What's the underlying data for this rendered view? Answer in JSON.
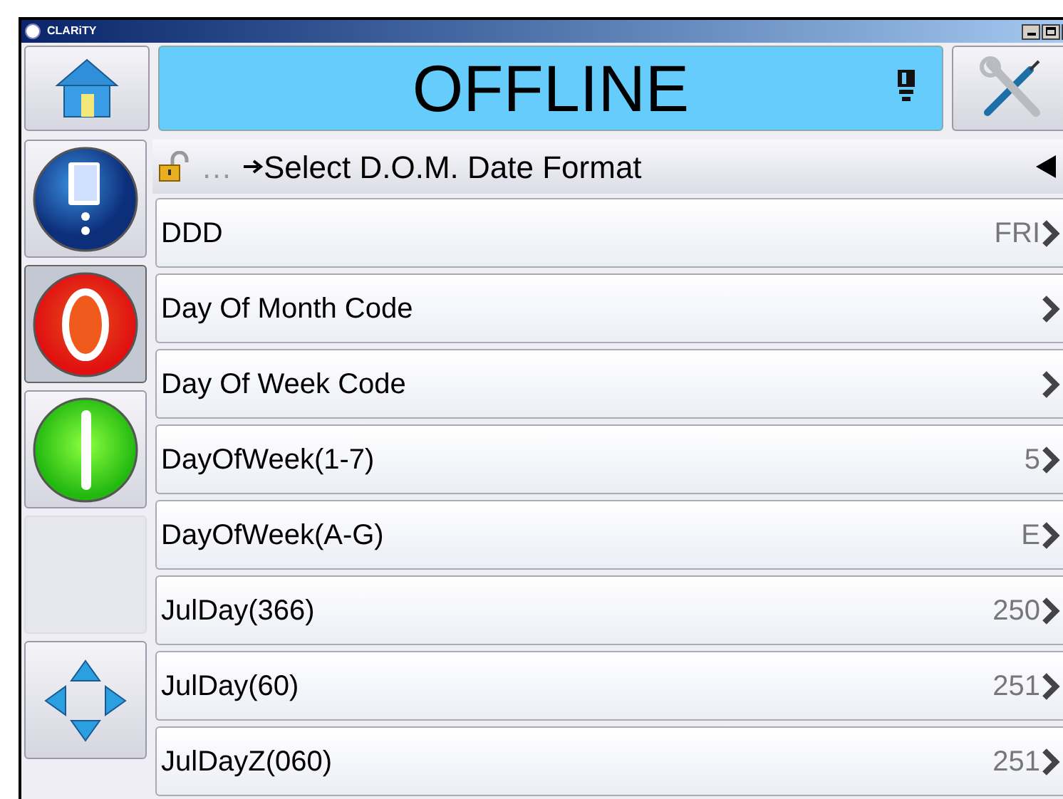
{
  "window": {
    "title": "CLARiTY"
  },
  "status": {
    "text": "OFFLINE"
  },
  "sidebar": [
    {
      "kind": "info",
      "selected": false
    },
    {
      "kind": "stop",
      "selected": true
    },
    {
      "kind": "start",
      "selected": false
    },
    {
      "kind": "empty",
      "selected": false
    },
    {
      "kind": "navigate",
      "selected": false
    }
  ],
  "breadcrumb": {
    "ellipsis": "…",
    "title": "Select D.O.M. Date Format"
  },
  "rows": [
    {
      "label": "DDD",
      "value": "FRI"
    },
    {
      "label": "Day Of Month Code"
    },
    {
      "label": "Day Of Week Code"
    },
    {
      "label": "DayOfWeek(1-7)",
      "value": "5"
    },
    {
      "label": "DayOfWeek(A-G)",
      "value": "E"
    },
    {
      "label": "JulDay(366)",
      "value": "250"
    },
    {
      "label": "JulDay(60)",
      "value": "251"
    },
    {
      "label": "JulDayZ(060)",
      "value": "251"
    }
  ]
}
